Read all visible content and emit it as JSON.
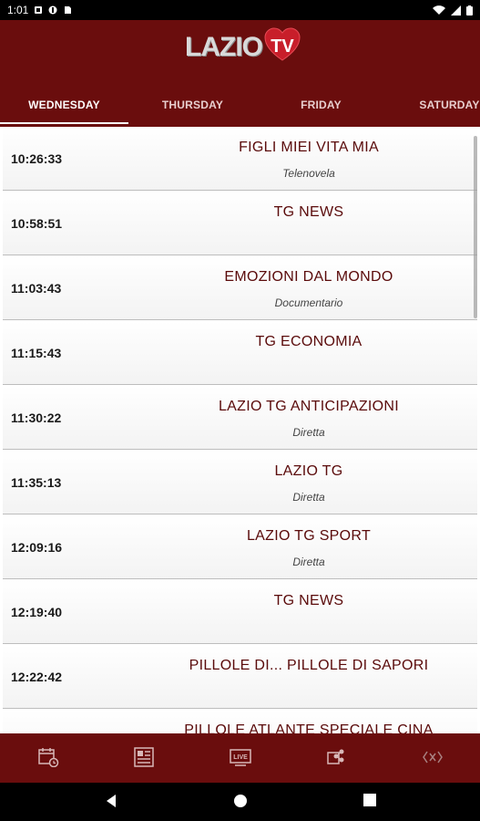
{
  "status": {
    "time": "1:01"
  },
  "brand": {
    "logo_text": "LAZIO",
    "logo_badge": "TV"
  },
  "tabs": [
    {
      "label": "WEDNESDAY",
      "active": true
    },
    {
      "label": "THURSDAY",
      "active": false
    },
    {
      "label": "FRIDAY",
      "active": false
    },
    {
      "label": "SATURDAY",
      "active": false
    }
  ],
  "schedule": [
    {
      "time": "10:26:33",
      "title": "FIGLI MIEI VITA MIA",
      "genre": "Telenovela"
    },
    {
      "time": "10:58:51",
      "title": "TG NEWS",
      "genre": ""
    },
    {
      "time": "11:03:43",
      "title": "EMOZIONI DAL MONDO",
      "genre": "Documentario"
    },
    {
      "time": "11:15:43",
      "title": "TG ECONOMIA",
      "genre": ""
    },
    {
      "time": "11:30:22",
      "title": "LAZIO TG ANTICIPAZIONI",
      "genre": "Diretta"
    },
    {
      "time": "11:35:13",
      "title": "LAZIO TG",
      "genre": "Diretta"
    },
    {
      "time": "12:09:16",
      "title": "LAZIO TG SPORT",
      "genre": "Diretta"
    },
    {
      "time": "12:19:40",
      "title": "TG NEWS",
      "genre": ""
    },
    {
      "time": "12:22:42",
      "title": "PILLOLE DI... PILLOLE DI SAPORI",
      "genre": ""
    },
    {
      "time": "",
      "title": "PILLOLE ATLANTE SPECIALE CINA",
      "genre": ""
    }
  ],
  "bottom_nav": [
    {
      "icon": "schedule-icon"
    },
    {
      "icon": "news-icon"
    },
    {
      "icon": "live-tv-icon"
    },
    {
      "icon": "share-icon"
    },
    {
      "icon": "code-icon"
    }
  ],
  "colors": {
    "brand": "#6a0d0d",
    "title_text": "#5a0a0a"
  }
}
